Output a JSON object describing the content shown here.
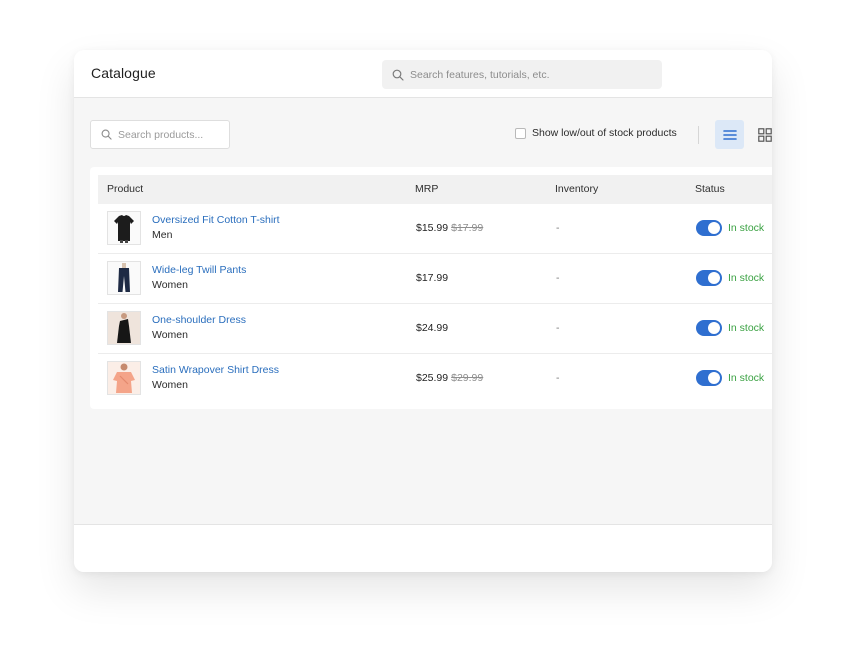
{
  "header": {
    "title": "Catalogue",
    "search_placeholder": "Search features, tutorials, etc."
  },
  "toolbar": {
    "search_placeholder": "Search products...",
    "stock_filter_label": "Show low/out of stock products",
    "stock_filter_checked": false,
    "view_mode": "list"
  },
  "table": {
    "columns": [
      "Product",
      "MRP",
      "Inventory",
      "Status"
    ],
    "rows": [
      {
        "name": "Oversized Fit Cotton T-shirt",
        "category": "Men",
        "price": "$15.99",
        "old_price": "$17.99",
        "inventory": "-",
        "status": "In stock",
        "enabled": true
      },
      {
        "name": "Wide-leg Twill Pants",
        "category": "Women",
        "price": "$17.99",
        "old_price": "",
        "inventory": "-",
        "status": "In stock",
        "enabled": true
      },
      {
        "name": "One-shoulder Dress",
        "category": "Women",
        "price": "$24.99",
        "old_price": "",
        "inventory": "-",
        "status": "In stock",
        "enabled": true
      },
      {
        "name": "Satin Wrapover Shirt Dress",
        "category": "Women",
        "price": "$25.99",
        "old_price": "$29.99",
        "inventory": "-",
        "status": "In stock",
        "enabled": true
      }
    ]
  },
  "colors": {
    "accent": "#2f6fd0",
    "link": "#2a6ebd",
    "in_stock": "#3aa142"
  },
  "icons": {
    "search": "search-icon",
    "list_view": "list-view-icon",
    "grid_view": "grid-view-icon"
  }
}
